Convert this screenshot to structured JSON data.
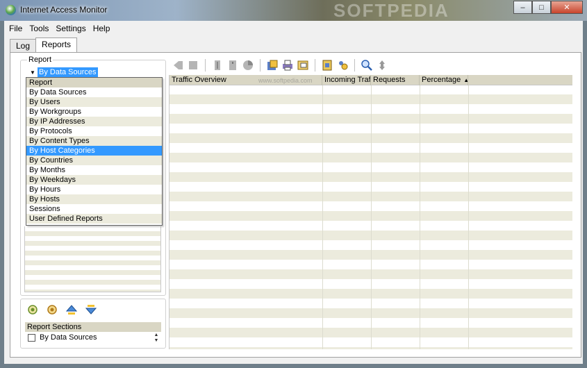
{
  "window": {
    "title": "Internet Access Monitor",
    "watermark": "SOFTPEDIA",
    "buttons": {
      "minimize": "–",
      "maximize": "□",
      "close": "✕"
    }
  },
  "menu": [
    "File",
    "Tools",
    "Settings",
    "Help"
  ],
  "tabs": [
    {
      "label": "Log",
      "active": false
    },
    {
      "label": "Reports",
      "active": true
    }
  ],
  "report": {
    "label": "Report",
    "selected": "By Data Sources",
    "options": [
      "Report",
      "By Data Sources",
      "By Users",
      "By Workgroups",
      "By IP Addresses",
      "By Protocols",
      "By Content Types",
      "By Host Categories",
      "By Countries",
      "By Months",
      "By Weekdays",
      "By Hours",
      "By Hosts",
      "Sessions",
      "User Defined Reports"
    ],
    "highlighted": "By Host Categories"
  },
  "sections": {
    "header": "Report Sections",
    "items": [
      {
        "label": "By Data Sources",
        "checked": false
      }
    ]
  },
  "grid": {
    "watermark": "www.softpedia.com",
    "columns": [
      "Traffic Overview",
      "Incoming Traf",
      "Requests",
      "Percentage"
    ],
    "sort_column": "Percentage",
    "sort_indicator": "▲"
  },
  "colors": {
    "selection": "#3399ff",
    "row_alt": "#ecebdd",
    "header": "#d9d6c4"
  }
}
